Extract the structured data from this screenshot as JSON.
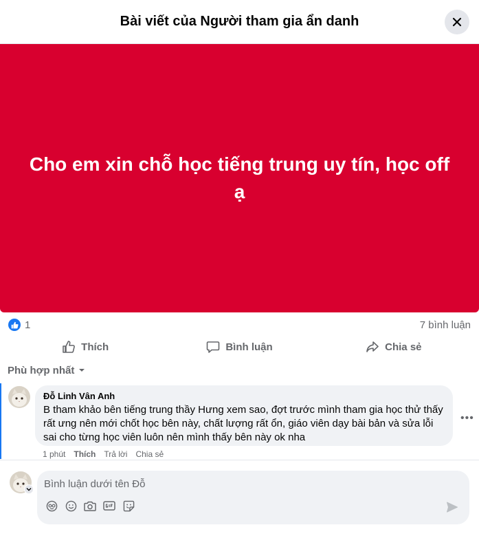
{
  "header": {
    "title": "Bài viết của Người tham gia ẩn danh"
  },
  "post": {
    "text": "Cho em xin chỗ học tiếng trung uy tín, học off ạ",
    "background_color": "#d8002f"
  },
  "stats": {
    "like_count": "1",
    "comment_count": "7 bình luận"
  },
  "actions": {
    "like_label": "Thích",
    "comment_label": "Bình luận",
    "share_label": "Chia sẻ"
  },
  "sort": {
    "label": "Phù hợp nhất"
  },
  "comments": [
    {
      "author": "Đỗ Linh Vân Anh",
      "text": "B tham khảo bên tiếng trung thầy Hưng xem sao, đợt trước mình tham gia học thử thấy rất ưng nên mới chốt học bên này, chất lượng rất ổn, giáo viên dạy bài bản và sửa lỗi sai cho từng học viên luôn nên mình thấy bên này ok nha",
      "time": "1 phút",
      "like": "Thích",
      "reply": "Trả lời",
      "share": "Chia sẻ"
    }
  ],
  "composer": {
    "placeholder": "Bình luận dưới tên Đỗ"
  },
  "colors": {
    "accent": "#1877f2",
    "muted": "#65676b",
    "surface": "#f0f2f5"
  }
}
